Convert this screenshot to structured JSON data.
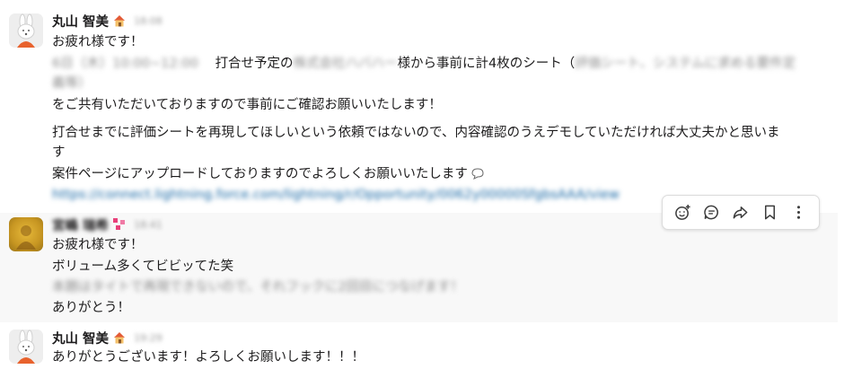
{
  "messages": [
    {
      "author": "丸山 智美",
      "status_icon": "house-emoji",
      "time": "18:08",
      "lines": [
        "お疲れ様です！",
        "打合せ予定の",
        "様から事前に計4枚のシート（",
        "をご共有いただいておりますので事前にご確認お願いいたします！",
        "打合せまでに評価シートを再現してほしいという依頼ではないので、内容確認のうえデモしていただければ大丈夫かと思いま",
        "す",
        "案件ページにアップロードしておりますのでよろしくお願いいたします"
      ],
      "blurred": {
        "date_time": "6日（木）10:00~12:00",
        "company": "株式会社ハバハー",
        "sheets": "評価シート、システムに求める要件定",
        "sheets_cont": "義等）",
        "link": "https://connect.lightning.force.com/lightning/r/Opportunity/0062y00000SfgbsAAA/view"
      }
    },
    {
      "author": "宮嶋 瑞希",
      "status_icon": "pink-sparkle-emoji",
      "time": "18:41",
      "lines": [
        "お疲れ様です！",
        "ボリューム多くてビビッてた笑",
        "ありがとう！"
      ],
      "blurred": {
        "line": "本題はタイトで再現できないので、それフックに2回目につなげます！"
      }
    },
    {
      "author": "丸山 智美",
      "status_icon": "house-emoji",
      "time": "19:29",
      "lines": [
        "ありがとうございます！よろしくお願いします！！！"
      ]
    }
  ],
  "actions": [
    {
      "name": "add-reaction",
      "icon": "smiley-plus-icon"
    },
    {
      "name": "reply-in-thread",
      "icon": "thread-bubble-icon"
    },
    {
      "name": "forward",
      "icon": "share-arrow-icon"
    },
    {
      "name": "save",
      "icon": "bookmark-icon"
    },
    {
      "name": "more",
      "icon": "vertical-dots-icon"
    }
  ],
  "colors": {
    "link": "#1264a3",
    "hover_bg": "#f8f8f8",
    "timestamp": "#9a9a9a"
  }
}
